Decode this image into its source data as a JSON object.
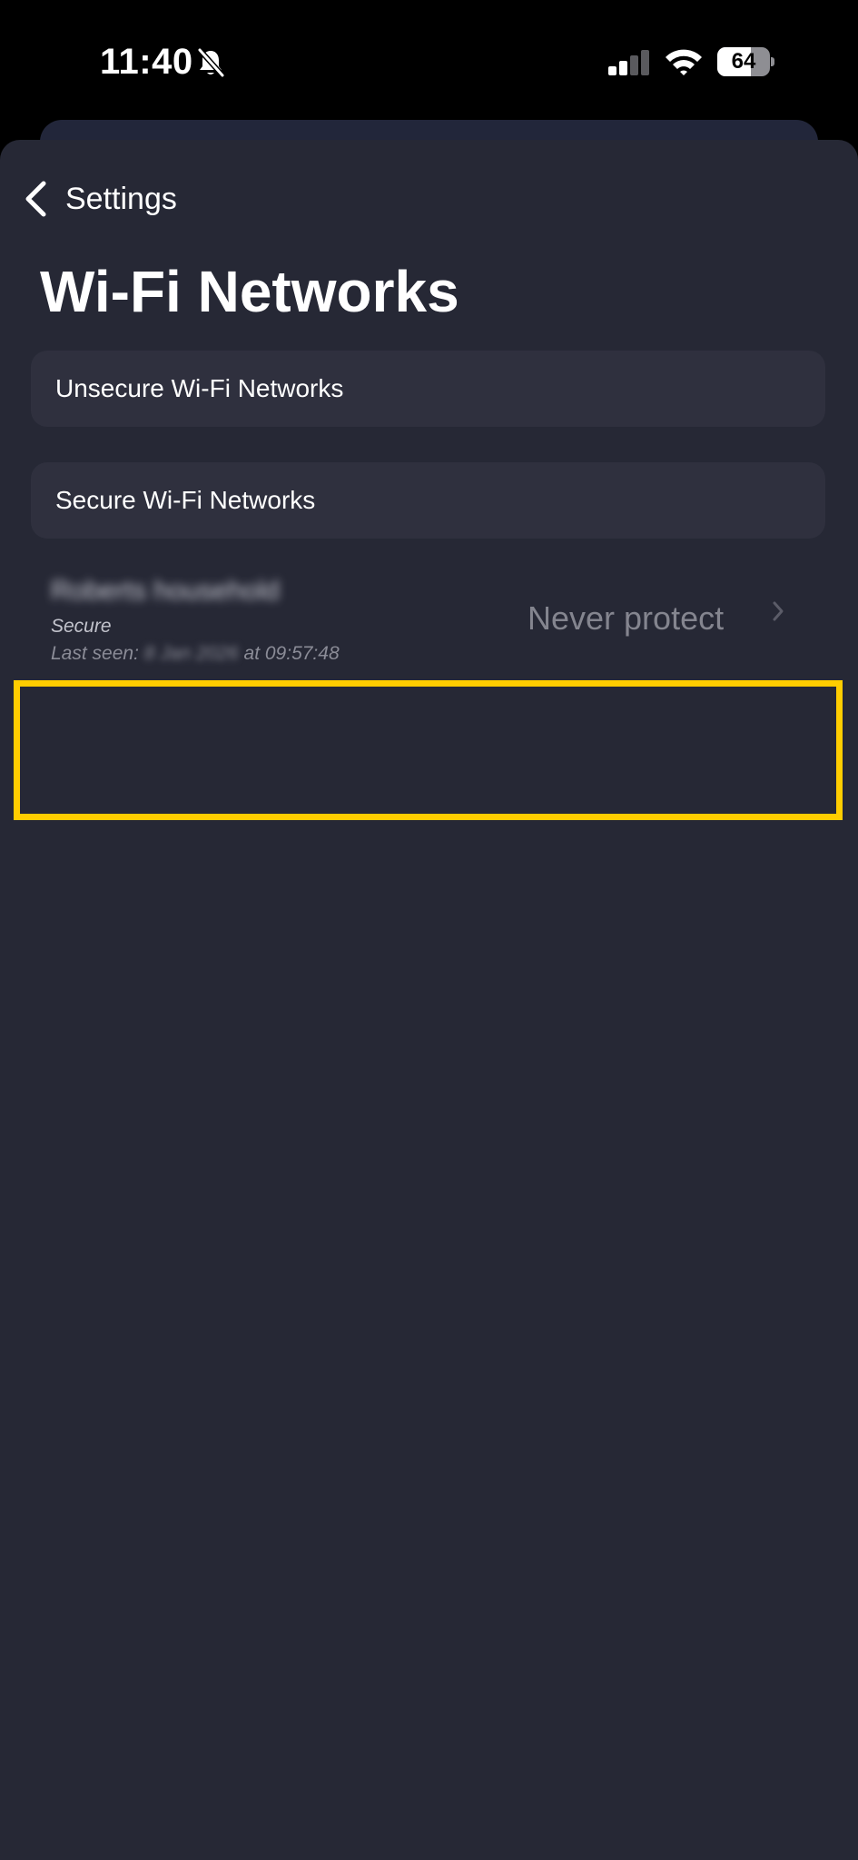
{
  "status_bar": {
    "time": "11:40",
    "battery_percent": 64,
    "battery_label": "64",
    "mute_icon": "bell-slash-icon",
    "signal_icon": "cellular-signal-icon",
    "signal_bars_active": 2,
    "wifi_icon": "wifi-icon"
  },
  "nav": {
    "back_label": "Settings",
    "back_icon": "chevron-left-icon"
  },
  "page": {
    "title": "Wi-Fi Networks"
  },
  "groups": {
    "unsecure_label": "Unsecure Wi-Fi Networks",
    "secure_label": "Secure Wi-Fi Networks"
  },
  "network": {
    "name": "Roberts household",
    "security": "Secure",
    "last_seen_prefix": "Last seen:",
    "last_seen_date": "8 Jan 2026",
    "last_seen_time": "at 09:57:48",
    "action": "Never protect",
    "chevron_icon": "chevron-right-icon"
  },
  "colors": {
    "background": "#262835",
    "row_background": "#2f303e",
    "highlight": "#ffcd00",
    "muted_text": "#84858f"
  }
}
